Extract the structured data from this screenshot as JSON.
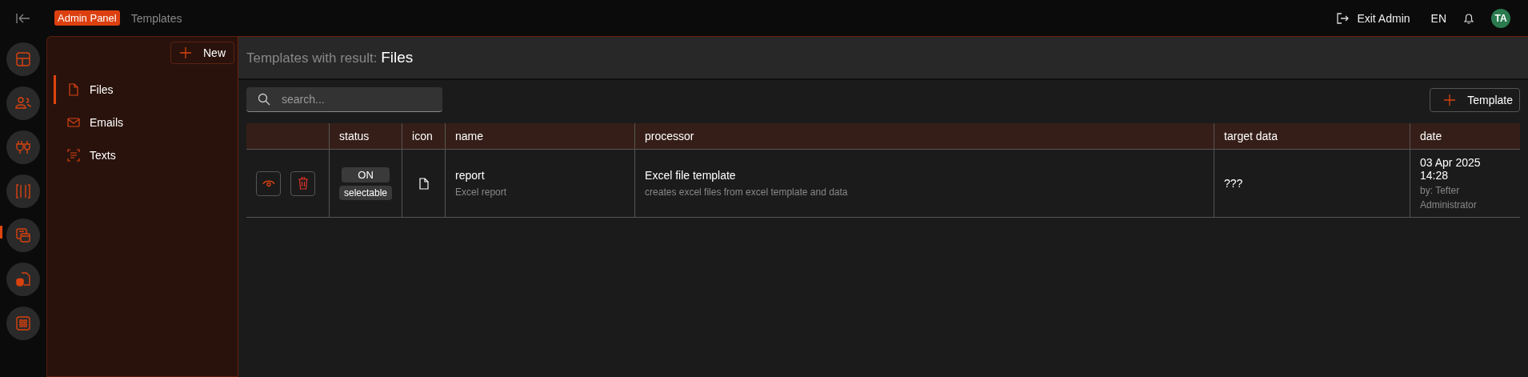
{
  "header": {
    "badge": "Admin Panel",
    "breadcrumb": "Templates",
    "exit": "Exit Admin",
    "language": "EN",
    "avatar": "TA"
  },
  "rail": [
    {
      "selected": false
    },
    {
      "selected": false
    },
    {
      "selected": false
    },
    {
      "selected": false
    },
    {
      "selected": true
    },
    {
      "selected": false
    },
    {
      "selected": false
    }
  ],
  "sidebar": {
    "new_button": "New",
    "items": [
      {
        "label": "Files",
        "selected": true
      },
      {
        "label": "Emails",
        "selected": false
      },
      {
        "label": "Texts",
        "selected": false
      }
    ]
  },
  "main": {
    "title_prefix": "Templates with result:",
    "title": "Files",
    "search": {
      "placeholder": "search..."
    },
    "add_button": "Template"
  },
  "table": {
    "columns": [
      "status",
      "icon",
      "name",
      "processor",
      "target data",
      "date"
    ],
    "rows": [
      {
        "status": "ON",
        "status_tag": "selectable",
        "name": "report",
        "description": "Excel report",
        "processor": "Excel file template",
        "processor_description": "creates excel files from excel template and data",
        "target_data": "???",
        "date": "03 Apr 2025 14:28",
        "author": "by: Tefter",
        "author_role": "Administrator"
      }
    ]
  }
}
